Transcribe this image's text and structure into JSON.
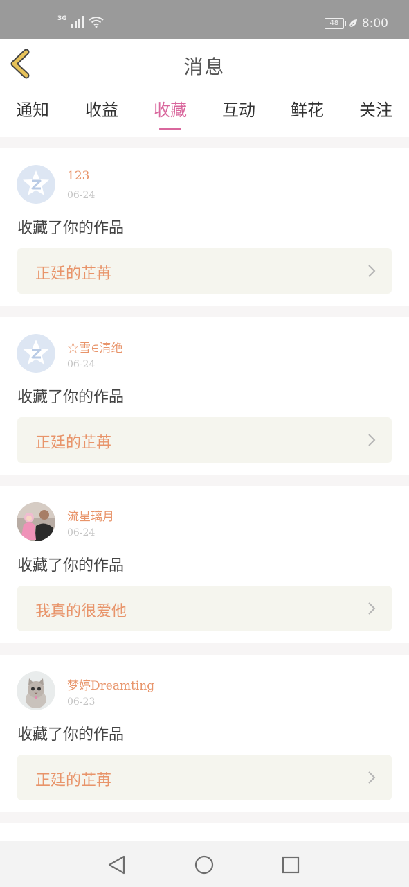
{
  "status_bar": {
    "network": "3G",
    "battery": "48",
    "time": "8:00"
  },
  "header": {
    "title": "消息"
  },
  "tabs": [
    {
      "label": "通知",
      "active": false
    },
    {
      "label": "收益",
      "active": false
    },
    {
      "label": "收藏",
      "active": true
    },
    {
      "label": "互动",
      "active": false
    },
    {
      "label": "鲜花",
      "active": false
    },
    {
      "label": "关注",
      "active": false
    }
  ],
  "notifications": [
    {
      "user": "123",
      "date": "06-24",
      "action": "收藏了你的作品",
      "work": "正廷的芷苒",
      "avatar": "qq-default"
    },
    {
      "user": "☆雪∈清绝",
      "date": "06-24",
      "action": "收藏了你的作品",
      "work": "正廷的芷苒",
      "avatar": "qq-default"
    },
    {
      "user": "流星璃月",
      "date": "06-24",
      "action": "收藏了你的作品",
      "work": "我真的很爱他",
      "avatar": "photo-people"
    },
    {
      "user": "梦婷Dreamting",
      "date": "06-23",
      "action": "收藏了你的作品",
      "work": "正廷的芷苒",
      "avatar": "photo-cat"
    }
  ],
  "colors": {
    "accent": "#d9679d",
    "name": "#e8946a",
    "back_icon": "#e7c25a"
  }
}
